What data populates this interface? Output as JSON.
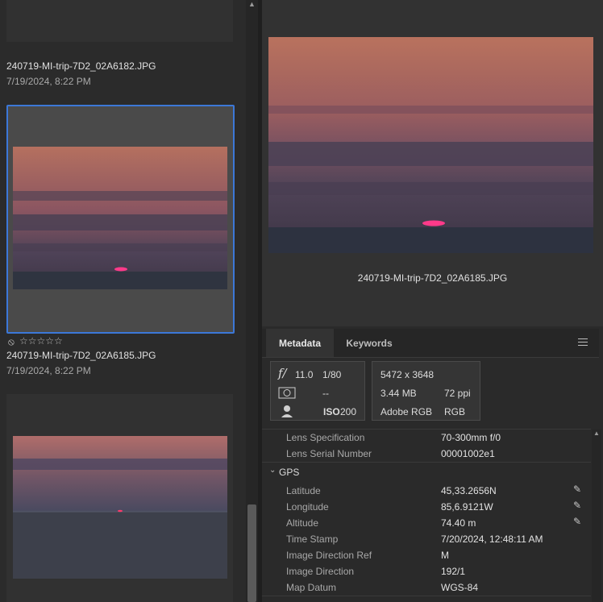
{
  "filmstrip": {
    "items": [
      {
        "filename": "240719-MI-trip-7D2_02A6182.JPG",
        "date": "7/19/2024, 8:22 PM"
      },
      {
        "filename": "240719-MI-trip-7D2_02A6185.JPG",
        "date": "7/19/2024, 8:22 PM",
        "rating_stars": "☆☆☆☆☆",
        "reject_icon": "reject-circle-icon",
        "selected": true
      },
      {
        "filename": "",
        "date": ""
      }
    ]
  },
  "preview": {
    "caption": "240719-MI-trip-7D2_02A6185.JPG"
  },
  "panel": {
    "tabs": [
      {
        "label": "Metadata",
        "active": true
      },
      {
        "label": "Keywords",
        "active": false
      }
    ],
    "menu_icon": "hamburger-menu-icon",
    "camera": {
      "aperture_symbol": "f/",
      "aperture": "11.0",
      "shutter": "1/80",
      "metering": "--",
      "iso_label": "ISO",
      "iso": "200"
    },
    "file": {
      "dimensions": "5472 x 3648",
      "size": "3.44 MB",
      "ppi": "72 ppi",
      "profile": "Adobe RGB",
      "mode": "RGB"
    },
    "rows_top": [
      {
        "label": "Lens Specification",
        "value": "70-300mm f/0"
      },
      {
        "label": "Lens Serial Number",
        "value": "00001002e1"
      }
    ],
    "gps_section": "GPS",
    "gps_rows": [
      {
        "label": "Latitude",
        "value": "45,33.2656N",
        "editable": true
      },
      {
        "label": "Longitude",
        "value": "85,6.9121W",
        "editable": true
      },
      {
        "label": "Altitude",
        "value": "74.40 m",
        "editable": true
      },
      {
        "label": "Time Stamp",
        "value": "7/20/2024, 12:48:11 AM"
      },
      {
        "label": "Image Direction Ref",
        "value": "M"
      },
      {
        "label": "Image Direction",
        "value": "192/1"
      },
      {
        "label": "Map Datum",
        "value": "WGS-84"
      }
    ]
  },
  "colors": {
    "selection_border": "#3c78d8",
    "sunset_sky": "#b77066",
    "sea": "#3a3d48"
  }
}
